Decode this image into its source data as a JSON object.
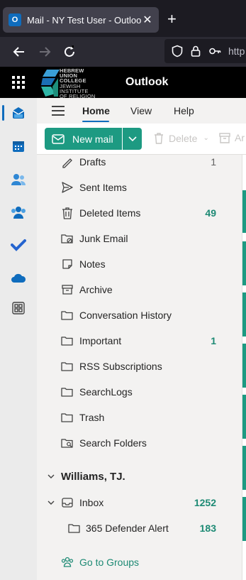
{
  "browser": {
    "tab_title": "Mail - NY Test User - Outlook",
    "favicon_letter": "O",
    "url_partial": "http"
  },
  "header": {
    "app_title": "Outlook",
    "logo_lines": [
      "HEBREW",
      "UNION",
      "COLLEGE",
      "JEWISH",
      "INSTITUTE",
      "OF RELIGION"
    ]
  },
  "ribbon": {
    "tabs": [
      "Home",
      "View",
      "Help"
    ],
    "new_mail_label": "New mail",
    "delete_label": "Delete",
    "archive_label": "Ar"
  },
  "folders": [
    {
      "label": "Drafts",
      "count": "1",
      "icon": "draft-icon"
    },
    {
      "label": "Sent Items",
      "count": "",
      "icon": "send-icon"
    },
    {
      "label": "Deleted Items",
      "count": "49",
      "icon": "trash-icon"
    },
    {
      "label": "Junk Email",
      "count": "",
      "icon": "junk-icon"
    },
    {
      "label": "Notes",
      "count": "",
      "icon": "note-icon"
    },
    {
      "label": "Archive",
      "count": "",
      "icon": "archive-icon"
    },
    {
      "label": "Conversation History",
      "count": "",
      "icon": "folder-icon"
    },
    {
      "label": "Important",
      "count": "1",
      "icon": "folder-icon"
    },
    {
      "label": "RSS Subscriptions",
      "count": "",
      "icon": "folder-icon"
    },
    {
      "label": "SearchLogs",
      "count": "",
      "icon": "folder-icon"
    },
    {
      "label": "Trash",
      "count": "",
      "icon": "folder-icon"
    },
    {
      "label": "Search Folders",
      "count": "",
      "icon": "search-folder-icon"
    }
  ],
  "account": {
    "name": "Williams, TJ.",
    "inbox_label": "Inbox",
    "inbox_count": "1252",
    "subfolder_label": "365 Defender Alert",
    "subfolder_count": "183"
  },
  "groups_link": "Go to Groups",
  "colors": {
    "accent": "#1d9a82",
    "brand_blue": "#0f6cbd"
  }
}
